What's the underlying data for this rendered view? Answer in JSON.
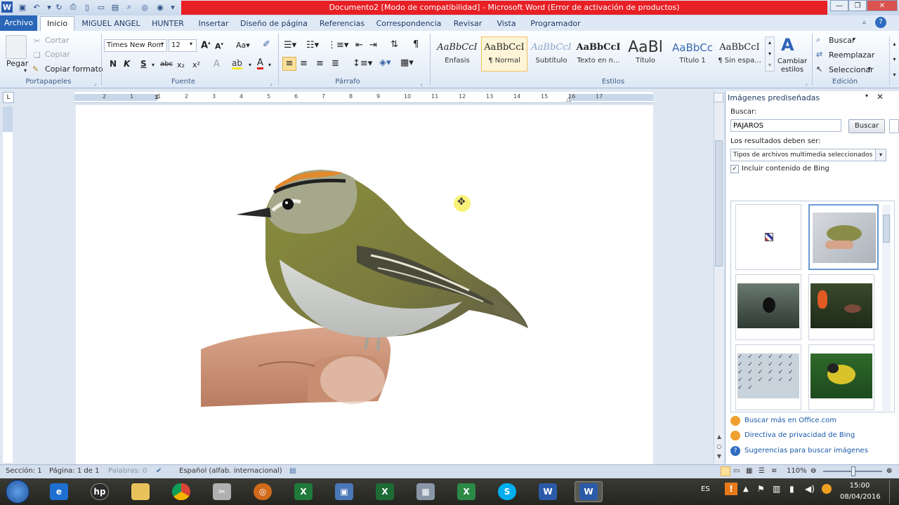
{
  "window": {
    "title": "Documento2 [Modo de compatibilidad]  -  Microsoft Word (Error de activación de productos)"
  },
  "tabs": [
    "Archivo",
    "Inicio",
    "MIGUEL ANGEL",
    "HUNTER",
    "Insertar",
    "Diseño de página",
    "Referencias",
    "Correspondencia",
    "Revisar",
    "Vista",
    "Programador"
  ],
  "clipboard": {
    "paste": "Pegar",
    "cut": "Cortar",
    "copy": "Copiar",
    "format_painter": "Copiar formato",
    "group": "Portapapeles"
  },
  "font": {
    "name": "Times New Rom",
    "size": "12",
    "group": "Fuente",
    "bold": "N",
    "italic": "K",
    "underline": "S",
    "strike": "abc",
    "sub": "x₂",
    "sup": "x²"
  },
  "paragraph": {
    "group": "Párrafo"
  },
  "styles": {
    "group": "Estilos",
    "items": [
      {
        "preview": "AaBbCcI",
        "name": "Énfasis"
      },
      {
        "preview": "AaBbCcI",
        "name": "¶ Normal"
      },
      {
        "preview": "AaBbCcI",
        "name": "Subtítulo"
      },
      {
        "preview": "AaBbCcI",
        "name": "Texto en n..."
      },
      {
        "preview": "AaBl",
        "name": "Título"
      },
      {
        "preview": "AaBbCc",
        "name": "Título 1"
      },
      {
        "preview": "AaBbCcI",
        "name": "¶ Sin espa..."
      }
    ],
    "change_styles": "Cambiar estilos"
  },
  "editing": {
    "find": "Buscar",
    "replace": "Reemplazar",
    "select": "Seleccionar",
    "group": "Edición"
  },
  "ruler": {
    "numbers": [
      "2",
      "1",
      "1",
      "2",
      "3",
      "4",
      "5",
      "6",
      "7",
      "8",
      "9",
      "10",
      "11",
      "12",
      "13",
      "14",
      "15",
      "16",
      "17"
    ]
  },
  "clipart_pane": {
    "title": "Imágenes prediseñadas",
    "search_label": "Buscar:",
    "search_value": "PAJAROS",
    "search_button": "Buscar",
    "results_label": "Los resultados deben ser:",
    "results_value": "Tipos de archivos multimedia seleccionados",
    "bing_checkbox": "Incluir contenido de Bing",
    "links": [
      "Buscar más en Office.com",
      "Directiva de privacidad de Bing",
      "Sugerencias para buscar imágenes"
    ]
  },
  "statusbar": {
    "section": "Sección: 1",
    "page": "Página: 1 de 1",
    "words": "Palabras: 0",
    "language": "Español (alfab. internacional)",
    "zoom": "110%"
  },
  "taskbar": {
    "lang": "ES",
    "time": "15:00",
    "date": "08/04/2016"
  },
  "colors": {
    "title_error": "#e81f24",
    "file_tab": "#2a67b8",
    "taskbar": "#2b2b26"
  }
}
